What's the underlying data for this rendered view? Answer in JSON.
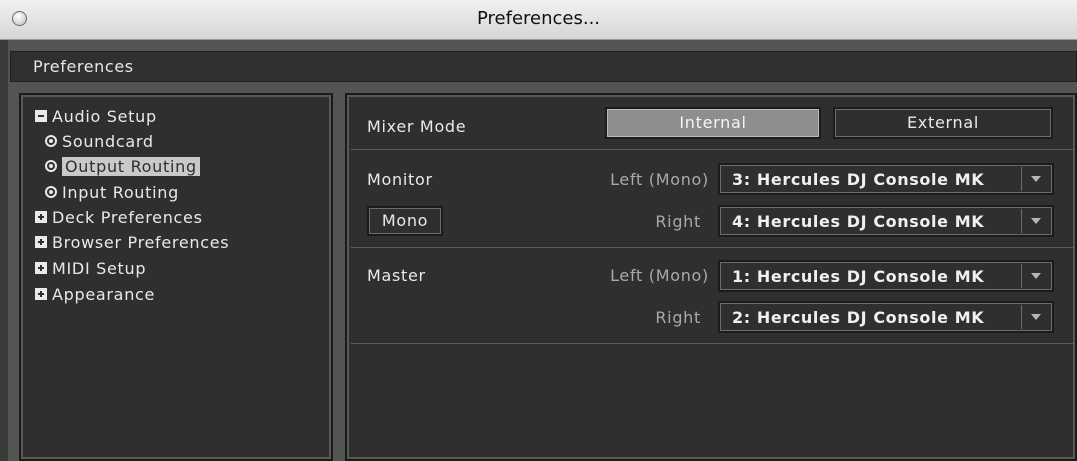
{
  "window": {
    "title": "Preferences..."
  },
  "header": {
    "title": "Preferences"
  },
  "sidebar": {
    "items": [
      {
        "label": "Audio Setup",
        "type": "group",
        "state": "expanded"
      },
      {
        "label": "Soundcard",
        "type": "leaf"
      },
      {
        "label": "Output Routing",
        "type": "leaf",
        "selected": true
      },
      {
        "label": "Input Routing",
        "type": "leaf"
      },
      {
        "label": "Deck Preferences",
        "type": "group",
        "state": "collapsed"
      },
      {
        "label": "Browser Preferences",
        "type": "group",
        "state": "collapsed"
      },
      {
        "label": "MIDI Setup",
        "type": "group",
        "state": "collapsed"
      },
      {
        "label": "Appearance",
        "type": "group",
        "state": "collapsed"
      }
    ]
  },
  "main": {
    "mixer_mode": {
      "label": "Mixer Mode",
      "options": [
        "Internal",
        "External"
      ],
      "selected": "Internal"
    },
    "monitor": {
      "label": "Monitor",
      "mono_button": "Mono",
      "left_label": "Left (Mono)",
      "left_value": "3: Hercules DJ Console MK",
      "right_label": "Right",
      "right_value": "4: Hercules DJ Console MK"
    },
    "master": {
      "label": "Master",
      "left_label": "Left (Mono)",
      "left_value": "1: Hercules DJ Console MK",
      "right_label": "Right",
      "right_value": "2: Hercules DJ Console MK"
    }
  },
  "colors": {
    "panel_bg": "#2e2f2e",
    "frame_bg": "#535553",
    "active_button": "#8d8f8d",
    "selection": "#c9c9c9"
  },
  "icons": {
    "collapse": "minus-box-icon",
    "expand": "plus-box-icon",
    "leaf": "radio-dot-icon",
    "dropdown": "chevron-down-icon"
  }
}
